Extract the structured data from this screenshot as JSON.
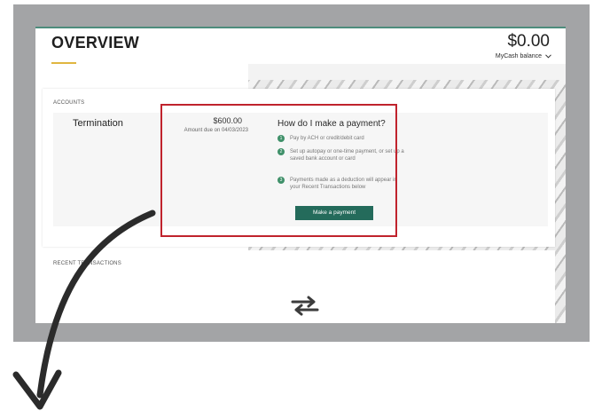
{
  "header": {
    "title": "OVERVIEW",
    "balance": "$0.00",
    "balance_link": "MyCash balance"
  },
  "accounts": {
    "section_label": "ACCOUNTS",
    "items": [
      {
        "name": "Termination",
        "amount": "$600.00",
        "due": "Amount due on 04/03/2023"
      }
    ]
  },
  "payment_help": {
    "title": "How do I make a payment?",
    "steps": [
      {
        "num": "1",
        "text": "Pay by ACH or credit/debit card"
      },
      {
        "num": "2",
        "text": "Set up autopay or one-time payment, or set up a saved bank account or card"
      },
      {
        "num": "3",
        "text": "Payments made as a deduction will appear in your Recent Transactions below"
      }
    ],
    "button_label": "Make a payment"
  },
  "recent": {
    "section_label": "RECENT TRANSACTIONS"
  },
  "colors": {
    "accent_green": "#246b5b",
    "step_green": "#3f9069",
    "highlight_red": "#c0232d",
    "underline_gold": "#e0b640",
    "frame_gray": "#a3a4a6"
  },
  "icons": [
    "transfer-arrows-icon",
    "chevron-down-icon",
    "curved-arrow-icon"
  ]
}
